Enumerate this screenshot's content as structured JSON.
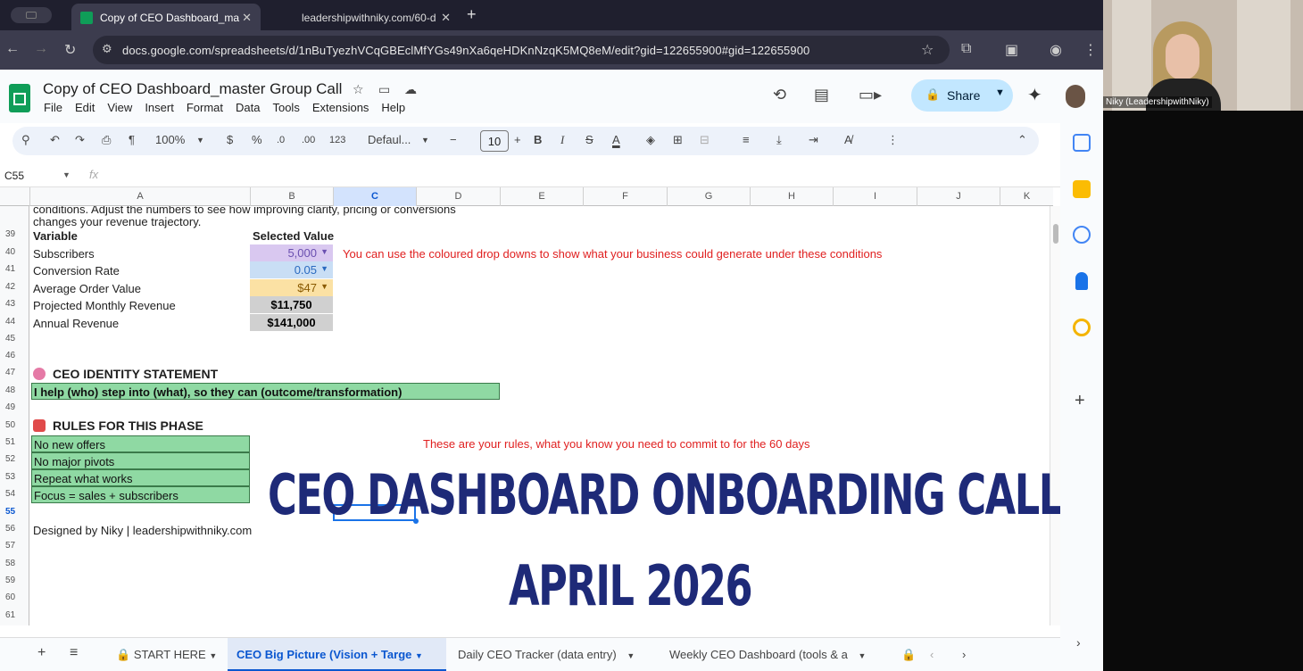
{
  "browser": {
    "tabs": [
      {
        "label": "Copy of CEO Dashboard_ma",
        "active": true
      },
      {
        "label": "leadershipwithniky.com/60-d",
        "active": false
      }
    ],
    "url": "docs.google.com/spreadsheets/d/1nBuTyezhVCqGBEclMfYGs49nXa6qeHDKnNzqK5MQ8eM/edit?gid=122655900#gid=122655900"
  },
  "doc": {
    "title": "Copy of CEO Dashboard_master Group Call",
    "menu": [
      "File",
      "Edit",
      "View",
      "Insert",
      "Format",
      "Data",
      "Tools",
      "Extensions",
      "Help"
    ],
    "share_label": "Share"
  },
  "toolbar": {
    "zoom": "100%",
    "currency": "$",
    "percent": "%",
    "dec_decrease": ".0",
    "dec_increase": ".00",
    "format_123": "123",
    "font": "Defaul...",
    "font_size": "10",
    "bold": "B",
    "italic": "I",
    "strike": "S",
    "textcolor": "A"
  },
  "formula_bar": {
    "name_box": "C55",
    "fx": "fx"
  },
  "columns": [
    "A",
    "B",
    "C",
    "D",
    "E",
    "F",
    "G",
    "H",
    "I",
    "J",
    "K"
  ],
  "rows": [
    "39",
    "40",
    "41",
    "42",
    "43",
    "44",
    "45",
    "46",
    "47",
    "48",
    "49",
    "50",
    "51",
    "52",
    "53",
    "54",
    "55",
    "56",
    "57",
    "58",
    "59",
    "60",
    "61"
  ],
  "sheet": {
    "intro_line1": "conditions. Adjust the numbers to see how improving clarity, pricing or conversions",
    "intro_line2": "changes your revenue trajectory.",
    "variable_header": "Variable",
    "selected_value_header": "Selected Value",
    "variables": [
      {
        "label": "Subscribers",
        "value": "5,000",
        "color": "#d9c8f0"
      },
      {
        "label": "Conversion Rate",
        "value": "0.05",
        "color": "#c9def5"
      },
      {
        "label": "Average Order Value",
        "value": "$47",
        "color": "#fbe1a4"
      },
      {
        "label": "Projected Monthly Revenue",
        "value": "$11,750",
        "color": "#d0d0d0"
      },
      {
        "label": "Annual Revenue",
        "value": "$141,000",
        "color": "#d0d0d0"
      }
    ],
    "dropdown_note": "You can use the coloured drop downs to show what your business could generate under these conditions",
    "identity_title": "CEO IDENTITY STATEMENT",
    "identity_statement": "I help (who) step into (what), so they can (outcome/transformation)",
    "rules_title": "RULES FOR THIS PHASE",
    "rules": [
      "No new offers",
      "No major pivots",
      "Repeat what works",
      "Focus = sales + subscribers"
    ],
    "rules_note": "These are your rules, what you know you need to commit to for the 60 days",
    "footer": "Designed by Niky | leadershipwithniky.com"
  },
  "overlay": {
    "line1": "CEO DASHBOARD ONBOARDING CALL",
    "line2": "APRIL 2026"
  },
  "sheet_tabs": [
    {
      "label": "START HERE",
      "active": false
    },
    {
      "label": "CEO Big Picture (Vision + Targe",
      "active": true
    },
    {
      "label": "Daily CEO Tracker (data entry)",
      "active": false
    },
    {
      "label": "Weekly CEO Dashboard (tools & a",
      "active": false
    }
  ],
  "webcam": {
    "name": "Niky (LeadershipwithNiky)"
  },
  "colors": {
    "accent": "#0b57d0",
    "sheets_green": "#0f9d58",
    "overlay_text": "#1e2a78",
    "note_red": "#e02020",
    "row_green": "#8fd9a3"
  }
}
